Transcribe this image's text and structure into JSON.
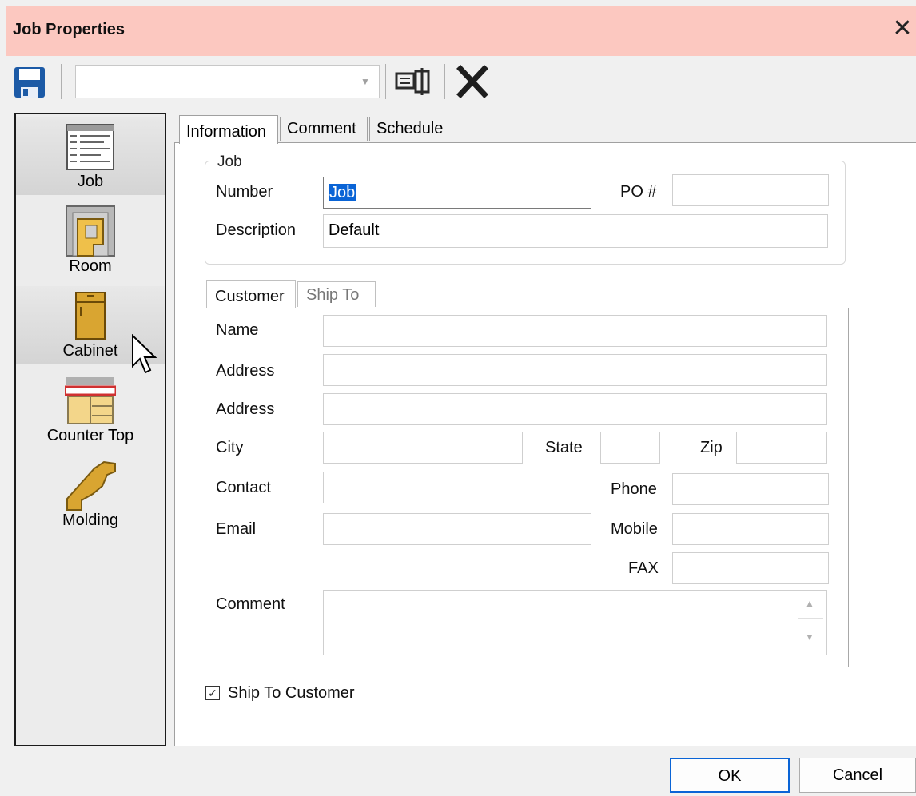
{
  "window": {
    "title": "Job Properties",
    "close_glyph": "✕"
  },
  "toolbar": {
    "save_icon": "save-floppy-icon",
    "combo_value": "",
    "layout_icon": "dual-panel-icon",
    "delete_icon": "delete-x-icon"
  },
  "nav": {
    "items": [
      {
        "label": "Job",
        "icon": "job-list-icon",
        "selected": true
      },
      {
        "label": "Room",
        "icon": "room-icon",
        "selected": false
      },
      {
        "label": "Cabinet",
        "icon": "cabinet-icon",
        "selected": true
      },
      {
        "label": "Counter Top",
        "icon": "countertop-icon",
        "selected": false
      },
      {
        "label": "Molding",
        "icon": "molding-icon",
        "selected": false
      }
    ]
  },
  "tabs": [
    {
      "label": "Information",
      "active": true
    },
    {
      "label": "Comment",
      "active": false
    },
    {
      "label": "Schedule",
      "active": false
    }
  ],
  "job_group": {
    "title": "Job",
    "number_label": "Number",
    "number_value": "Job",
    "po_label": "PO #",
    "po_value": "",
    "description_label": "Description",
    "description_value": "Default"
  },
  "customer_tabs": [
    {
      "label": "Customer",
      "active": true
    },
    {
      "label": "Ship To",
      "active": false
    }
  ],
  "customer": {
    "name_label": "Name",
    "name_value": "",
    "address1_label": "Address",
    "address1_value": "",
    "address2_label": "Address",
    "address2_value": "",
    "city_label": "City",
    "city_value": "",
    "state_label": "State",
    "state_value": "",
    "zip_label": "Zip",
    "zip_value": "",
    "contact_label": "Contact",
    "contact_value": "",
    "phone_label": "Phone",
    "phone_value": "",
    "email_label": "Email",
    "email_value": "",
    "mobile_label": "Mobile",
    "mobile_value": "",
    "fax_label": "FAX",
    "fax_value": "",
    "comment_label": "Comment",
    "comment_value": ""
  },
  "ship_to_customer": {
    "label": "Ship To Customer",
    "checked": true
  },
  "buttons": {
    "ok": "OK",
    "cancel": "Cancel"
  },
  "colors": {
    "titlebar": "#fcc8c0",
    "accent": "#0a64d6",
    "icon_gold": "#d9a531",
    "save_blue": "#1c5aa6"
  }
}
